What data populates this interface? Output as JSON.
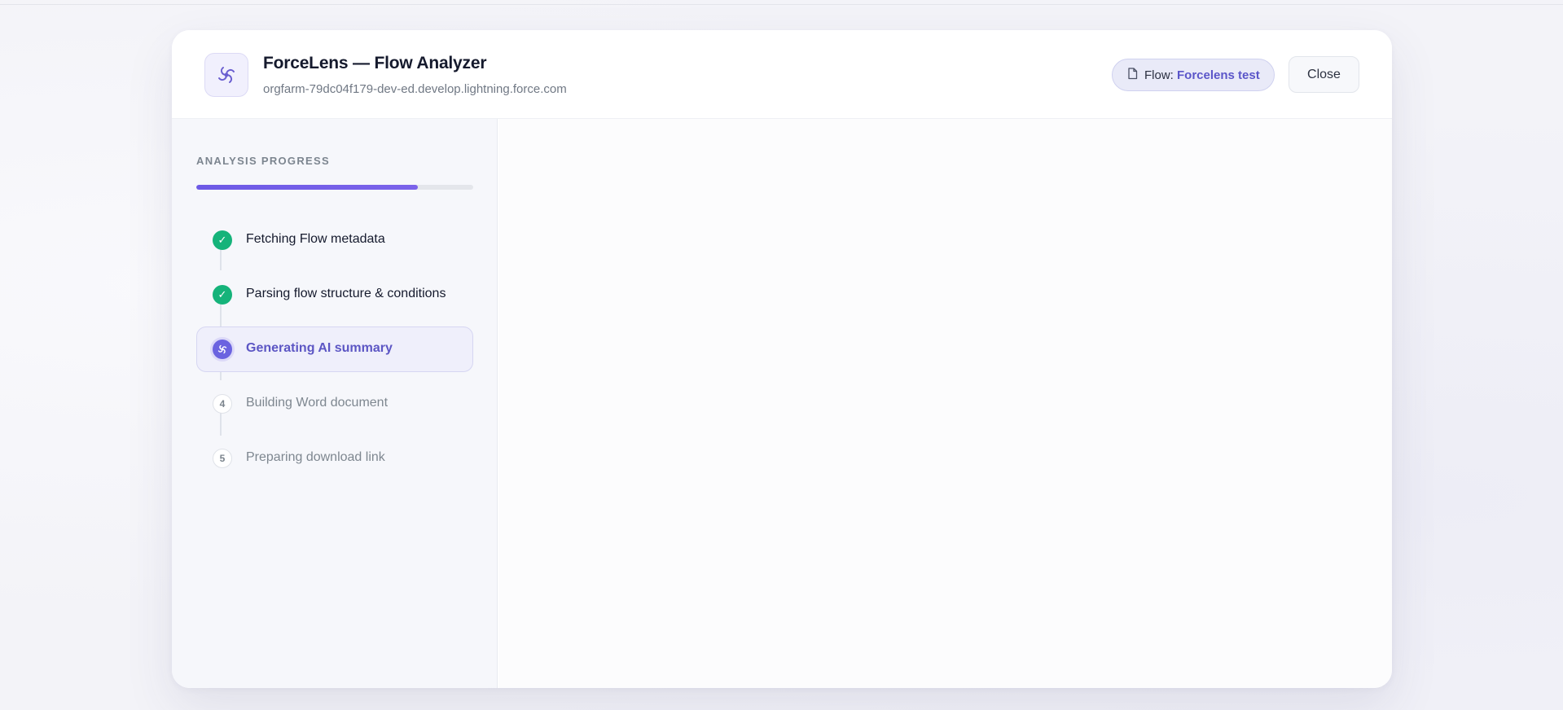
{
  "header": {
    "title": "ForceLens — Flow Analyzer",
    "subtitle": "orgfarm-79dc04f179-dev-ed.develop.lightning.force.com",
    "app_icon": "spiral-logo-icon",
    "flow_prefix": "Flow:",
    "flow_name": "Forcelens test",
    "flow_icon": "document-icon",
    "close_label": "Close"
  },
  "sidebar": {
    "section_label": "ANALYSIS PROGRESS",
    "progress_percent": 80,
    "steps": [
      {
        "status": "done",
        "marker": "✓",
        "label": "Fetching Flow metadata"
      },
      {
        "status": "done",
        "marker": "✓",
        "label": "Parsing flow structure & conditions"
      },
      {
        "status": "active",
        "marker": "",
        "label": "Generating AI summary"
      },
      {
        "status": "pending",
        "marker": "4",
        "label": "Building Word document"
      },
      {
        "status": "pending",
        "marker": "5",
        "label": "Preparing download link"
      }
    ]
  },
  "colors": {
    "accent": "#6b63e0",
    "success": "#15b37a",
    "progress": "#6d5ae6",
    "link": "#5b56c9"
  }
}
